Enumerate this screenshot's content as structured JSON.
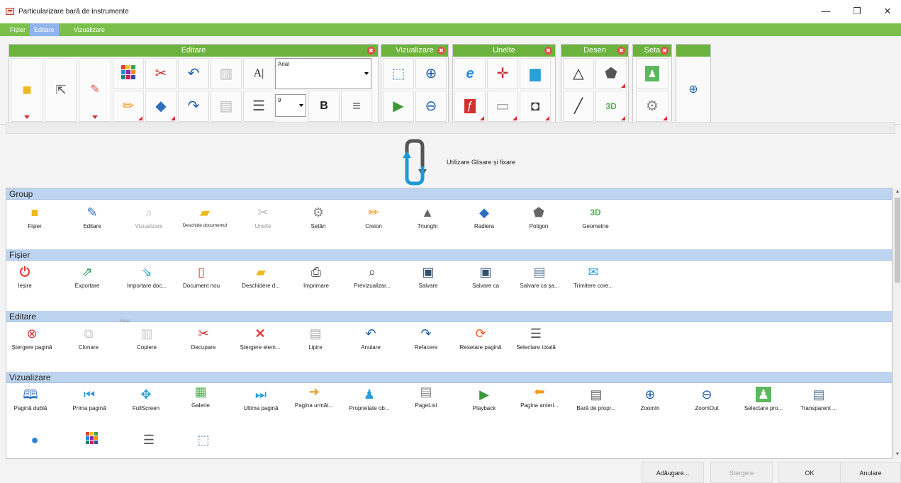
{
  "window": {
    "title": "Particularizare bară de instrumente",
    "minimize": "—",
    "restore": "❐",
    "close": "✕"
  },
  "menu": [
    "Fișier",
    "Editare",
    "Vizualizare"
  ],
  "ribbon": {
    "groups": [
      "Editare",
      "Vizualizare",
      "Unelte",
      "Desen",
      "Seta"
    ],
    "close_glyph": "✖",
    "font_name": "Arial",
    "font_size": "9",
    "bold": "B",
    "add_glyph": "⊕"
  },
  "drag_label": "Utilizare Glisare și fixare",
  "sections": {
    "group": {
      "title": "Group",
      "items": [
        "Fișier",
        "Editare",
        "Vizualizare",
        "Deschide documentul",
        "Unelte",
        "Setări",
        "Creion",
        "Triunghi",
        "Radiera",
        "Poligon",
        "Geometrie"
      ]
    },
    "fisier": {
      "title": "Fișier",
      "items": [
        "Ieșire",
        "Exportare",
        "Importare doc...",
        "Document nou",
        "Deschidere d...",
        "Imprimare",
        "Previzualizar...",
        "Salvare",
        "Salvare ca",
        "Salvare ca șa...",
        "Trimitere core..."
      ]
    },
    "editare": {
      "title": "Editare",
      "items": [
        "Ștergere pagină",
        "Clonare",
        "Copiere",
        "Decupare",
        "Ștergere elem...",
        "Lipire",
        "Anulare",
        "Refacere",
        "Resetare pagină",
        "Selectare totală"
      ],
      "floating_label": "Fișier"
    },
    "vizualizare": {
      "title": "Vizualizare",
      "items": [
        "Pagină dublă",
        "Prima pagină",
        "FullScreen",
        "Galerie",
        "Ultima pagină",
        "Pagina următ...",
        "Proprietate ob...",
        "PageList",
        "Playback",
        "Pagina anteri...",
        "Bară de propr...",
        "ZoomIn",
        "ZoomOut",
        "Selectare pro...",
        "Transparent ..."
      ]
    }
  },
  "footer": {
    "add": "Adăugare...",
    "delete": "Ștergere",
    "ok": "OK",
    "cancel": "Anulare"
  },
  "icons": {
    "folder": "folder-icon",
    "edit": "edit-icon",
    "view": "view-icon",
    "open": "open-document-icon",
    "tools": "tools-icon",
    "settings": "gear-icon",
    "pencil": "pencil-icon",
    "triangle": "triangle-icon",
    "eraser": "eraser-icon",
    "polygon": "pentagon-icon",
    "geometry": "geometry-3d-icon"
  },
  "colors": {
    "menu_green": "#7cc04b",
    "group_green": "#6cb33e",
    "section_blue": "#bdd4f0",
    "active_menu": "#8fb4ee",
    "exit_red": "#e53935",
    "delete_red": "#e53935"
  }
}
